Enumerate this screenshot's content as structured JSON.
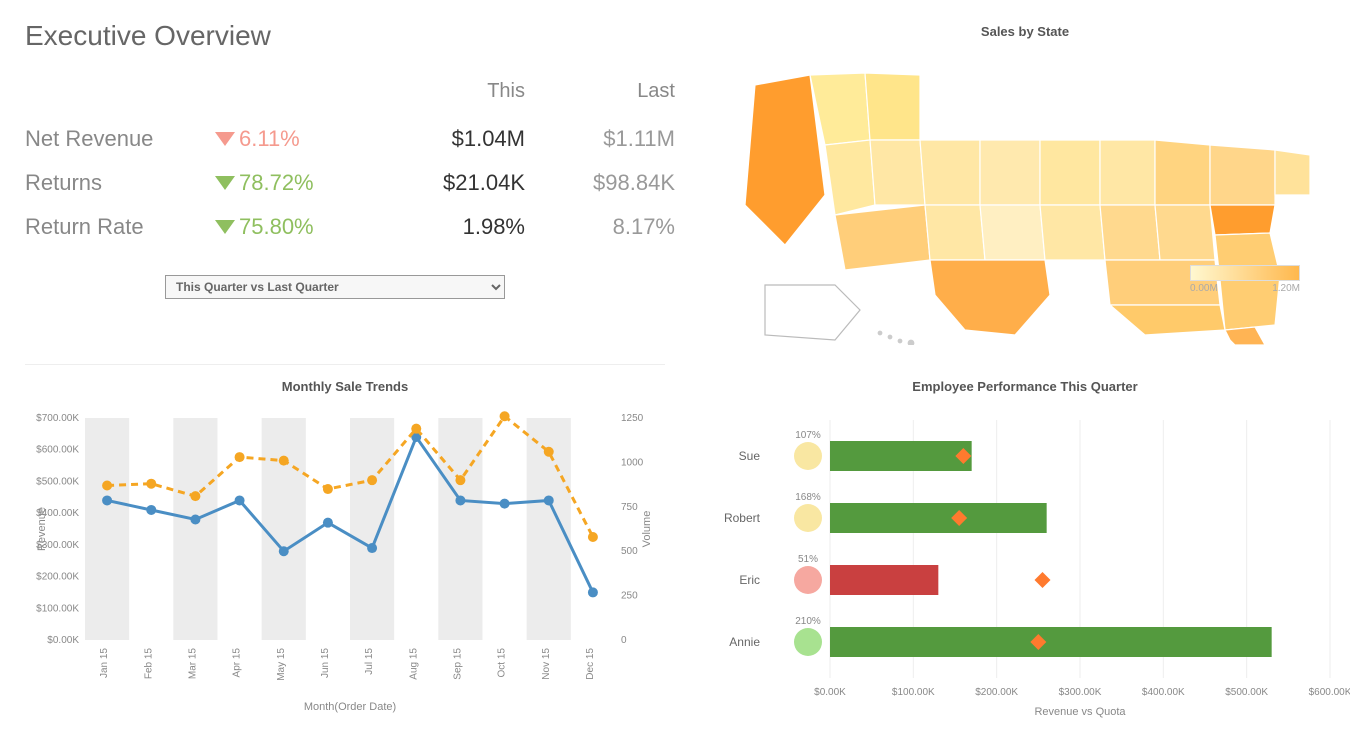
{
  "exec": {
    "title": "Executive Overview",
    "header_this": "This",
    "header_last": "Last",
    "rows": [
      {
        "label": "Net Revenue",
        "dir": "down",
        "delta": "6.11%",
        "this": "$1.04M",
        "last": "$1.11M"
      },
      {
        "label": "Returns",
        "dir": "up",
        "delta": "78.72%",
        "this": "$21.04K",
        "last": "$98.84K"
      },
      {
        "label": "Return Rate",
        "dir": "up",
        "delta": "75.80%",
        "this": "1.98%",
        "last": "8.17%"
      }
    ],
    "period_select": "This Quarter vs Last Quarter"
  },
  "map": {
    "title": "Sales by State",
    "legend_min": "0.00M",
    "legend_max": "1.20M"
  },
  "trends": {
    "title": "Monthly Sale Trends",
    "y1_label": "Revenue",
    "y2_label": "Volume",
    "x_label": "Month(Order Date)",
    "y1_ticks": [
      "$0.00K",
      "$100.00K",
      "$200.00K",
      "$300.00K",
      "$400.00K",
      "$500.00K",
      "$600.00K",
      "$700.00K"
    ],
    "y2_ticks": [
      "0",
      "250",
      "500",
      "750",
      "1000",
      "1250"
    ]
  },
  "emp": {
    "title": "Employee Performance This Quarter",
    "x_label": "Revenue vs Quota",
    "x_ticks": [
      "$0.00K",
      "$100.00K",
      "$200.00K",
      "$300.00K",
      "$400.00K",
      "$500.00K",
      "$600.00K"
    ]
  },
  "chart_data": [
    {
      "id": "monthly_trends",
      "type": "line",
      "dual_axis": true,
      "categories": [
        "Jan 15",
        "Feb 15",
        "Mar 15",
        "Apr 15",
        "May 15",
        "Jun 15",
        "Jul 15",
        "Aug 15",
        "Sep 15",
        "Oct 15",
        "Nov 15",
        "Dec 15"
      ],
      "series": [
        {
          "name": "Revenue",
          "axis": "left",
          "color": "#4a8ec4",
          "values": [
            440,
            410,
            380,
            440,
            280,
            370,
            290,
            640,
            440,
            430,
            440,
            150
          ]
        },
        {
          "name": "Volume",
          "axis": "right",
          "color": "#f5a623",
          "style": "dashed",
          "values": [
            870,
            880,
            810,
            1030,
            1010,
            850,
            900,
            1190,
            900,
            1260,
            1060,
            580
          ]
        }
      ],
      "y1": {
        "label": "Revenue",
        "min": 0,
        "max": 700,
        "unit": "K$"
      },
      "y2": {
        "label": "Volume",
        "min": 0,
        "max": 1250
      },
      "xlabel": "Month(Order Date)"
    },
    {
      "id": "employee_performance",
      "type": "bar",
      "orientation": "horizontal",
      "categories": [
        "Sue",
        "Robert",
        "Eric",
        "Annie"
      ],
      "series": [
        {
          "name": "Revenue",
          "values": [
            170,
            260,
            130,
            530
          ],
          "colors": [
            "#549a3e",
            "#549a3e",
            "#c94040",
            "#549a3e"
          ]
        },
        {
          "name": "Quota",
          "values": [
            160,
            155,
            255,
            250
          ],
          "marker": "diamond",
          "color": "#ff7a2e"
        }
      ],
      "percent_labels": [
        "107%",
        "168%",
        "51%",
        "210%"
      ],
      "status_colors": [
        "#f9e7a2",
        "#f9e7a2",
        "#f6a8a0",
        "#a8e290"
      ],
      "x": {
        "min": 0,
        "max": 600,
        "unit": "K$",
        "label": "Revenue vs Quota"
      }
    },
    {
      "id": "sales_by_state",
      "type": "choropleth_map",
      "region": "USA",
      "value_range": [
        0.0,
        1.2
      ],
      "unit": "M$",
      "title": "Sales by State",
      "highlighted_examples": {
        "California": 1.2,
        "Texas": 0.9,
        "Pennsylvania": 0.95,
        "Florida": 0.6
      }
    }
  ]
}
